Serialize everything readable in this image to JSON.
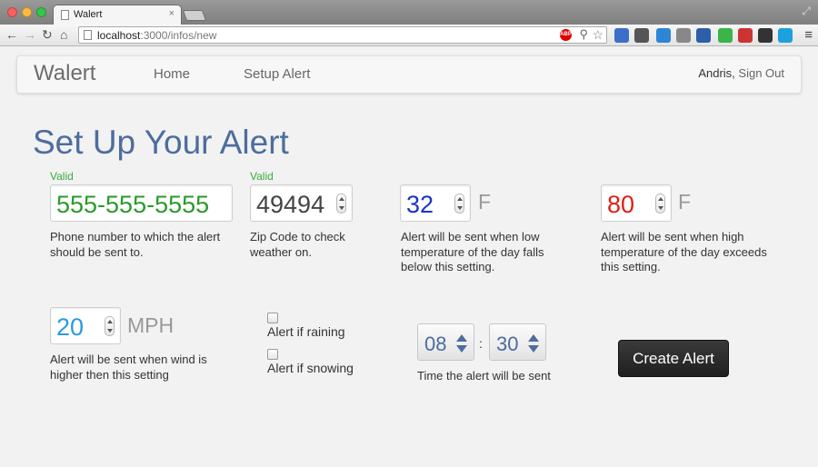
{
  "browser": {
    "tab_title": "Walert",
    "tab_close": "×",
    "url_host": "localhost",
    "url_path": ":3000/infos/new",
    "abp_label": "ABP",
    "fullscreen_glyph": "⤢",
    "menu_glyph": "≡"
  },
  "nav": {
    "brand": "Walert",
    "home": "Home",
    "setup_alert": "Setup Alert",
    "user": "Andris,",
    "sign_out": "Sign Out"
  },
  "page_title": "Set Up Your Alert",
  "phone": {
    "valid": "Valid",
    "value": "555-555-5555",
    "help": "Phone number to which the alert should be sent to."
  },
  "zip": {
    "valid": "Valid",
    "value": "49494",
    "help": "Zip Code to check weather on."
  },
  "low_temp": {
    "value": "32",
    "unit": "F",
    "help": "Alert will be sent when low temperature of the day falls below this setting."
  },
  "high_temp": {
    "value": "80",
    "unit": "F",
    "help": "Alert will be sent when high temperature of the day exceeds this setting."
  },
  "wind": {
    "value": "20",
    "unit": "MPH",
    "help": "Alert will be sent when wind is higher then this setting"
  },
  "rain": {
    "label": "Alert if raining",
    "checked": false
  },
  "snow": {
    "label": "Alert if snowing",
    "checked": false
  },
  "time": {
    "hour": "08",
    "separator": ":",
    "minute": "30",
    "help": "Time the alert will be sent"
  },
  "create_button": "Create Alert",
  "colors": {
    "title": "#4d6d9d",
    "valid": "#3caa3c",
    "phone": "#2a9a2a",
    "zip": "#444444",
    "low_temp": "#1a33cc",
    "high_temp": "#dd2211",
    "wind": "#2a9ae0"
  }
}
